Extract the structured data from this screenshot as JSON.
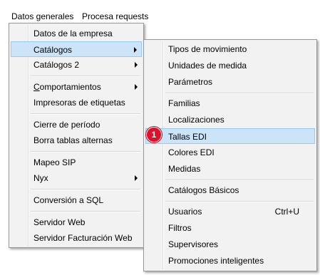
{
  "menubar": {
    "datos_generales": "Datos generales",
    "procesa_requests": "Procesa requests"
  },
  "main_menu": {
    "items": [
      {
        "label": "Datos de la empresa"
      },
      {
        "label": "Catálogos"
      },
      {
        "label": "Catálogos 2"
      },
      {
        "label_mnemonic": "C",
        "label_rest": "omportamientos"
      },
      {
        "label": "Impresoras de etiquetas"
      },
      {
        "label": "Cierre de período"
      },
      {
        "label": "Borra tablas alternas"
      },
      {
        "label": "Mapeo SIP"
      },
      {
        "label": "Nyx"
      },
      {
        "label": "Conversión a SQL"
      },
      {
        "label": "Servidor Web"
      },
      {
        "label": "Servidor Facturación Web"
      }
    ]
  },
  "sub_menu": {
    "items": [
      {
        "label": "Tipos de movimiento"
      },
      {
        "label": "Unidades de medida"
      },
      {
        "label": "Parámetros"
      },
      {
        "label": "Familias"
      },
      {
        "label": "Localizaciones"
      },
      {
        "label": "Tallas EDI"
      },
      {
        "label": "Colores EDI"
      },
      {
        "label": "Medidas"
      },
      {
        "label": "Catálogos Básicos"
      },
      {
        "label": "Usuarios",
        "shortcut": "Ctrl+U"
      },
      {
        "label": "Filtros"
      },
      {
        "label": "Supervisores"
      },
      {
        "label": "Promociones inteligentes"
      }
    ]
  },
  "callout": {
    "number": "1"
  },
  "colors": {
    "selected_bg": "#cce4f7",
    "selected_border": "#99c9ef",
    "badge": "#e0102a",
    "menu_bg": "#f2f2f2"
  }
}
